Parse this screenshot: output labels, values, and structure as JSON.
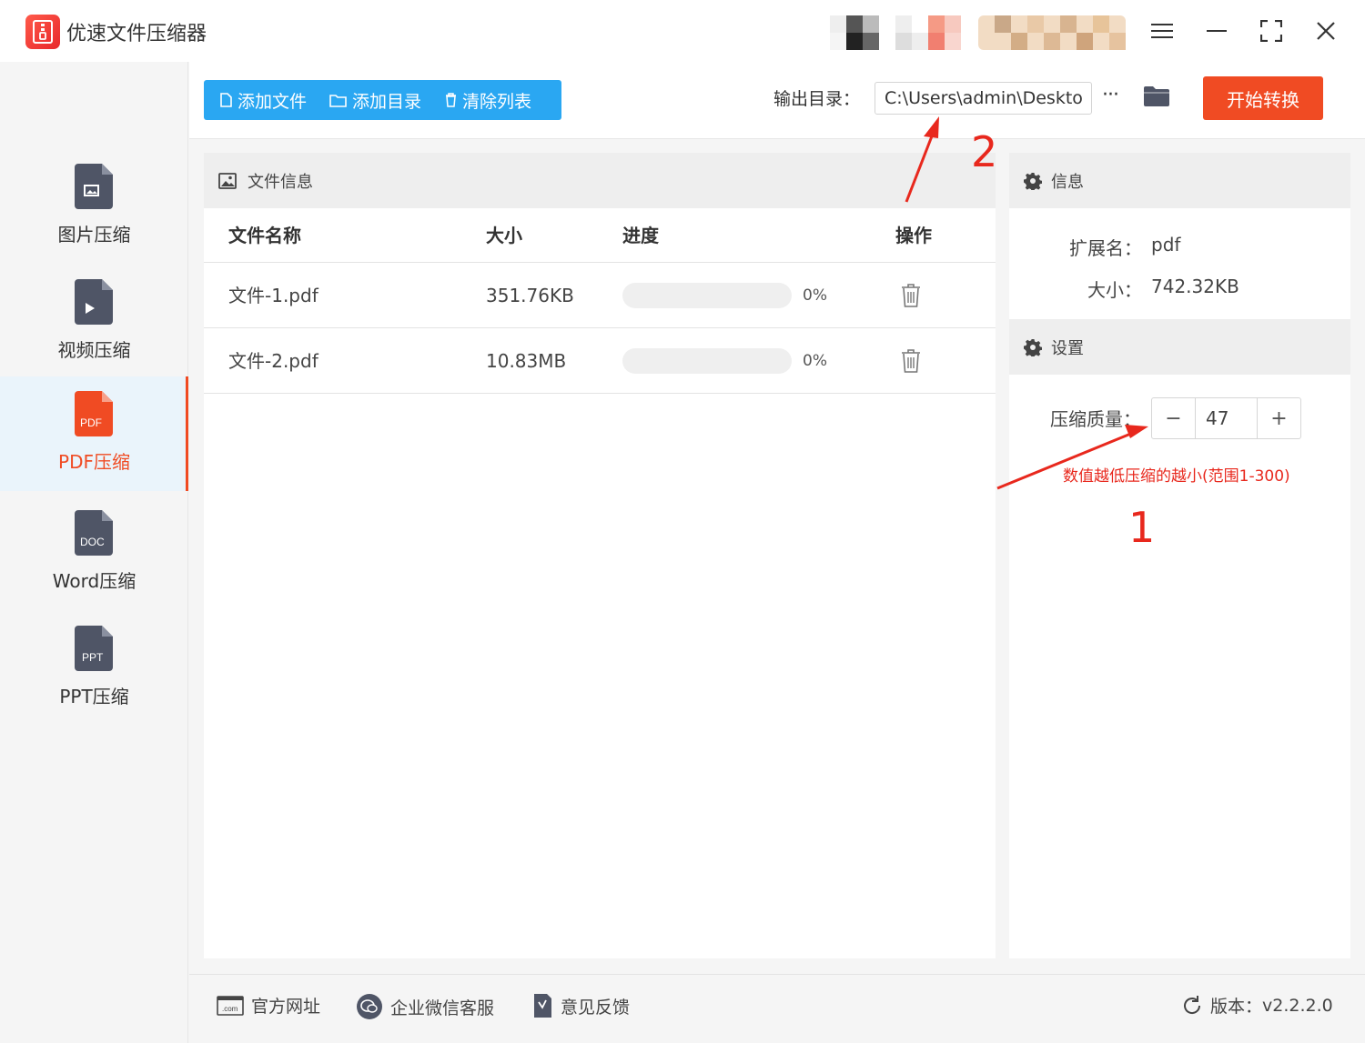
{
  "app": {
    "title": "优速文件压缩器"
  },
  "window_controls": [
    "menu-icon",
    "minimize-icon",
    "fullscreen-icon",
    "close-icon"
  ],
  "sidebar": {
    "items": [
      {
        "label": "图片压缩",
        "icon_text": "",
        "icon": "image-file-icon",
        "active": false
      },
      {
        "label": "视频压缩",
        "icon_text": "",
        "icon": "video-file-icon",
        "active": false
      },
      {
        "label": "PDF压缩",
        "icon_text": "PDF",
        "icon": "pdf-file-icon",
        "active": true
      },
      {
        "label": "Word压缩",
        "icon_text": "DOC",
        "icon": "doc-file-icon",
        "active": false
      },
      {
        "label": "PPT压缩",
        "icon_text": "PPT",
        "icon": "ppt-file-icon",
        "active": false
      }
    ]
  },
  "toolbar": {
    "add_file": "添加文件",
    "add_folder": "添加目录",
    "clear_list": "清除列表",
    "output_label": "输出目录：",
    "output_path": "C:\\Users\\admin\\Deskto",
    "more": "···",
    "start": "开始转换"
  },
  "file_panel": {
    "title": "文件信息",
    "columns": [
      "文件名称",
      "大小",
      "进度",
      "操作"
    ],
    "rows": [
      {
        "name": "文件-1.pdf",
        "size": "351.76KB",
        "progress": "0%"
      },
      {
        "name": "文件-2.pdf",
        "size": "10.83MB",
        "progress": "0%"
      }
    ]
  },
  "info_panel": {
    "title": "信息",
    "ext_label": "扩展名：",
    "ext_value": "pdf",
    "size_label": "大小：",
    "size_value": "742.32KB"
  },
  "settings_panel": {
    "title": "设置",
    "quality_label": "压缩质量：",
    "quality_value": "47",
    "minus": "−",
    "plus": "+",
    "hint": "数值越低压缩的越小(范围1-300)"
  },
  "annotations": {
    "one": "1",
    "two": "2"
  },
  "footer": {
    "website": "官方网址",
    "wechat": "企业微信客服",
    "feedback": "意见反馈",
    "version_label": "版本：",
    "version": "v2.2.2.0"
  },
  "colors": {
    "accent": "#f04b23",
    "blue": "#2aa7f2",
    "annotation": "#e8281d"
  }
}
